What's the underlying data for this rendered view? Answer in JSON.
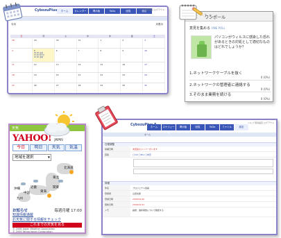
{
  "calendar": {
    "logo": "CybozuPlus 5",
    "menu": [
      "ホーム",
      "カレンダー",
      "掲示板",
      "ToDo",
      "回覧",
      "設定"
    ],
    "utility": "ヘルプ 環境設定 ログアウト",
    "tools_left": "今月",
    "tools_right": "月表示",
    "dow": [
      "日",
      "月",
      "火",
      "水",
      "木",
      "金",
      "土"
    ],
    "weeks": [
      [
        "28",
        "29",
        "30",
        "31",
        "1",
        "2",
        "3"
      ],
      [
        "4",
        "5",
        "6",
        "7",
        "8",
        "9",
        "10"
      ],
      [
        "11",
        "12",
        "13",
        "14",
        "15",
        "16",
        "17"
      ],
      [
        "18",
        "19",
        "20",
        "21",
        "22",
        "23",
        "24"
      ],
      [
        "25",
        "26",
        "27",
        "28",
        "29",
        "30",
        "31"
      ]
    ],
    "events": [
      "10:00 会議",
      "13:00 打合せ",
      "15:00 来客"
    ],
    "colors": {
      "border": "#8a82c9",
      "menu": "#3a57b8"
    }
  },
  "poll": {
    "title": "ワンポール",
    "window_buttons": "? ✕",
    "heading": "意見を集める",
    "heading_suffix": "ONE POLL",
    "question": "パソコンがウィルスに感染した恐れがあるときの対処として適切なものはどれでしょうか？",
    "options": [
      {
        "label": "1.ネットワークケーブルを抜く",
        "count": "0 (0%)"
      },
      {
        "label": "2.ネットワークの管理者に連絡する",
        "count": "0 (0%)"
      },
      {
        "label": "3.そのまま業務を続ける",
        "count": "0 (0%)"
      }
    ]
  },
  "weather": {
    "panel_title": "天気",
    "logo": "YAHOO!",
    "logo_sub": "JAPAN",
    "tabs": [
      "今日",
      "明日",
      "天気",
      "気温"
    ],
    "region_select": "地域を選択",
    "cities": [
      "北海道",
      "東北",
      "関東",
      "東海",
      "近畿",
      "九州",
      "沖縄",
      "中国"
    ],
    "news_label": "お知らせ",
    "news_time": "毎週月曜 17:00",
    "links": [
      "知識情報満載",
      "お天気に関する情報をチェック",
      "これまでの天気を見る"
    ],
    "copyright": [
      "© 2008 Japan Weather Association",
      "© 2009 Yahoo Japan Corporation"
    ]
  },
  "form": {
    "logo": "CybozuPlus 5",
    "menu": [
      "ホーム",
      "スケジュール",
      "掲示板",
      "回覧",
      "ToDo",
      "ファイル",
      "設定"
    ],
    "utility": "ヘルプ 環境設定 ログアウト",
    "breadcrumb": "ホーム",
    "section1": "日程調整",
    "rows1": [
      {
        "k": "候補日時",
        "v": "未回答のメンバーがいます"
      },
      {
        "k": "回答",
        "v": "◯OK ◯NG ◯未定"
      }
    ],
    "section2": "詳細",
    "rows2": [
      {
        "k": "件名",
        "v": "プロジェクト会議"
      },
      {
        "k": "登録者",
        "v": "山田太郎"
      },
      {
        "k": "登録日時",
        "v": "2009/01/20"
      },
      {
        "k": "更新日時",
        "v": "2009/01/21"
      },
      {
        "k": "メモ",
        "v": "議題：進捗報告について確認する"
      }
    ]
  }
}
